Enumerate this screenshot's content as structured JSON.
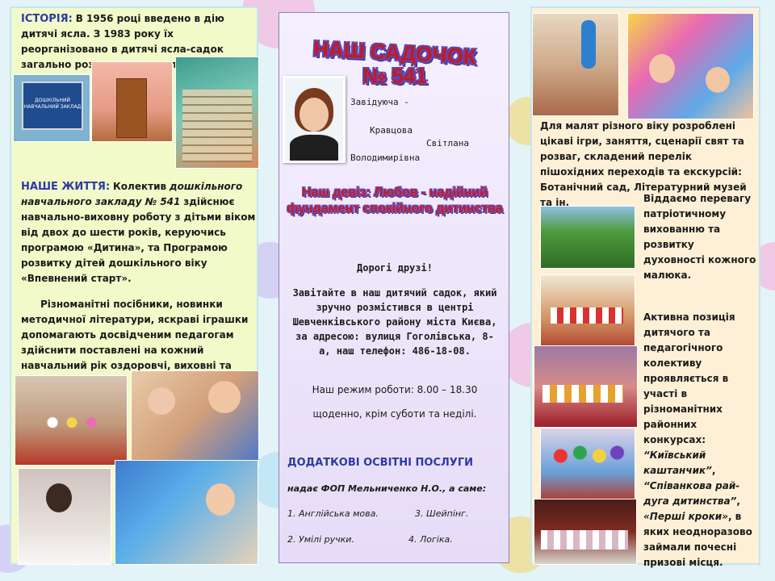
{
  "left": {
    "history_label": "ІСТОРІЯ:",
    "history_text": "В 1956 році введено в дію дитячі ясла. З 1983 року їх реорганізовано в дитячі ясла-садок загально розвиваючого типу.",
    "plaque_text": "ДОШКІЛЬНИЙ НАВЧАЛЬНИЙ ЗАКЛАД",
    "life_label": "НАШЕ ЖИТТЯ:",
    "life_intro": "Колектив",
    "life_italic": "дошкільного навчального закладу № 541",
    "life_rest": "здійснює навчально-виховну роботу з дітьми віком від двох до шести років, керуючись програмою «Дитина», та Програмою розвитку дітей дошкільного віку «Впевнений старт».",
    "manuals_text": "Різноманітні посібники, новинки методичної літератури, яскраві іграшки допомагають досвідченим педагогам здійснити поставлені на кожний навчальний рік оздоровчі, виховні та освітні завдання."
  },
  "middle": {
    "title_line1": "НАШ САДОЧОК",
    "title_line2": "№ 541",
    "director_label": "Завідуюча -",
    "director_surname": "Кравцова",
    "director_name": "Світлана",
    "director_patronymic": "Володимирівна",
    "motto": "Наш девіз: Любов - надійний фундамент спокійного дитинства",
    "greeting": "Дорогі друзі!",
    "invite_text": "Завітайте в наш дитячий садок, який зручно розмістився в центрі Шевченківського району міста Києва, за адресою: вулиця Гоголівська, 8-а, наш телефон: 486-18-08.",
    "hours_text": "Наш режим роботи: 8.00 – 18.30",
    "days_text": "щоденно, крім суботи та неділі.",
    "services_title": "ДОДАТКОВІ ОСВІТНІ ПОСЛУГИ",
    "services_provider": "надає ФОП Мельниченко Н.О., а саме:",
    "service_1": "1. Англійська мова.",
    "service_2": "2. Умілі ручки.",
    "service_3": "3. Шейпінг.",
    "service_4": "4. Логіка."
  },
  "right": {
    "games_text": "Для малят різного віку розроблені цікаві ігри, заняття, сценарії свят та розваг, складений перелік пішохідних переходів та екскурсій: Ботанічний сад, Літературний музей та ін.",
    "patriotic_text": "Віддаємо перевагу патріотичному вихованню та розвитку духовності кожного малюка.",
    "active_text": "Активна позиція дитячого та педагогічного колективу проявляється в участі в різноманітних районних конкурсах:",
    "contest_1": "“Київський каштанчик”",
    "contest_2": "“Співанкова рай-дуга дитинства”",
    "contest_3": "«Перші кроки»",
    "active_end": ", в яких неодноразово займали почесні призові місця."
  },
  "colors": {
    "accent_blue": "#2c3aa3",
    "title_red": "#c91818",
    "title_outline": "#5c48b5",
    "left_bg": "#f1fac8",
    "right_bg": "#fdf0d6"
  }
}
